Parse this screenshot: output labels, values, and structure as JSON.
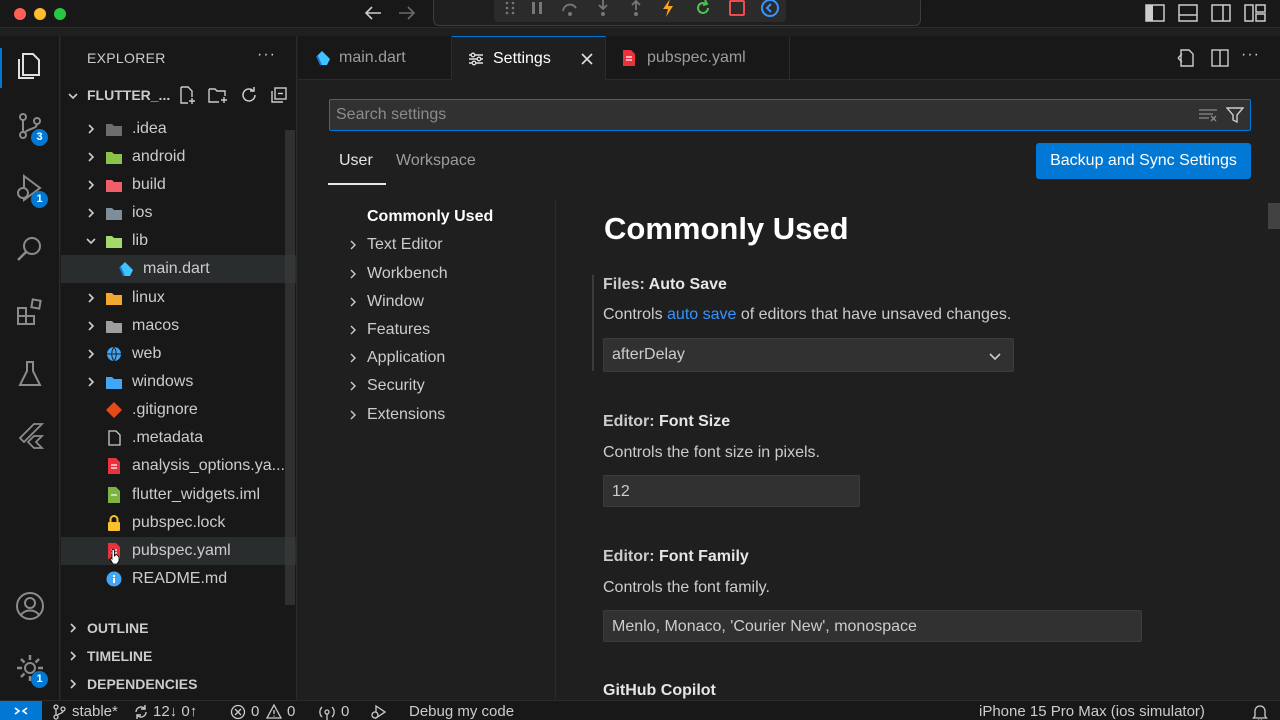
{
  "colors": {
    "accent": "#0078d4",
    "traffic_close": "#ff5f57",
    "traffic_min": "#febc2e",
    "traffic_max": "#28c840",
    "dart_blue": "#40c4ff",
    "yaml_red": "#e8323c"
  },
  "activity_bar": {
    "items": [
      {
        "name": "explorer-icon",
        "badge": ""
      },
      {
        "name": "source-control-icon",
        "badge": "3"
      },
      {
        "name": "run-debug-icon",
        "badge": "1"
      },
      {
        "name": "search-icon",
        "badge": ""
      },
      {
        "name": "extensions-icon",
        "badge": ""
      },
      {
        "name": "testing-icon",
        "badge": ""
      },
      {
        "name": "flutter-icon",
        "badge": ""
      }
    ],
    "accounts_icon": "account-icon",
    "manage_badge": "1"
  },
  "sidebar": {
    "title": "EXPLORER",
    "more": "···",
    "folder": "FLUTTER_...",
    "tree": [
      {
        "label": ".idea",
        "type": "folder",
        "expanded": false,
        "icon": "idea-folder-icon"
      },
      {
        "label": "android",
        "type": "folder",
        "expanded": false,
        "icon": "android-folder-icon"
      },
      {
        "label": "build",
        "type": "folder",
        "expanded": false,
        "icon": "build-folder-icon"
      },
      {
        "label": "ios",
        "type": "folder",
        "expanded": false,
        "icon": "ios-folder-icon"
      },
      {
        "label": "lib",
        "type": "folder",
        "expanded": true,
        "icon": "lib-folder-icon"
      },
      {
        "label": "main.dart",
        "type": "file",
        "icon": "dart-file-icon",
        "selected": true
      },
      {
        "label": "linux",
        "type": "folder",
        "expanded": false,
        "icon": "linux-folder-icon"
      },
      {
        "label": "macos",
        "type": "folder",
        "expanded": false,
        "icon": "macos-folder-icon"
      },
      {
        "label": "web",
        "type": "folder",
        "expanded": false,
        "icon": "web-folder-icon"
      },
      {
        "label": "windows",
        "type": "folder",
        "expanded": false,
        "icon": "windows-folder-icon"
      },
      {
        "label": ".gitignore",
        "type": "file",
        "icon": "git-file-icon"
      },
      {
        "label": ".metadata",
        "type": "file",
        "icon": "file-icon"
      },
      {
        "label": "analysis_options.ya...",
        "type": "file",
        "icon": "yaml-file-icon"
      },
      {
        "label": "flutter_widgets.iml",
        "type": "file",
        "icon": "iml-file-icon"
      },
      {
        "label": "pubspec.lock",
        "type": "file",
        "icon": "lock-file-icon"
      },
      {
        "label": "pubspec.yaml",
        "type": "file",
        "icon": "yaml-file-icon",
        "hovered": true
      },
      {
        "label": "README.md",
        "type": "file",
        "icon": "info-file-icon"
      }
    ],
    "sections": [
      "OUTLINE",
      "TIMELINE",
      "DEPENDENCIES"
    ]
  },
  "tabs": [
    {
      "label": "main.dart",
      "icon": "dart-file-icon",
      "active": false
    },
    {
      "label": "Settings",
      "icon": "settings-tab-icon",
      "active": true
    },
    {
      "label": "pubspec.yaml",
      "icon": "yaml-file-icon",
      "active": false
    }
  ],
  "settings": {
    "search_placeholder": "Search settings",
    "scopes": [
      "User",
      "Workspace"
    ],
    "sync_button": "Backup and Sync Settings",
    "toc": [
      "Commonly Used",
      "Text Editor",
      "Workbench",
      "Window",
      "Features",
      "Application",
      "Security",
      "Extensions"
    ],
    "heading": "Commonly Used",
    "items": [
      {
        "category": "Files: ",
        "name": "Auto Save",
        "desc_pre": "Controls ",
        "desc_link": "auto save",
        "desc_post": " of editors that have unsaved changes.",
        "value": "afterDelay"
      },
      {
        "category": "Editor: ",
        "name": "Font Size",
        "desc": "Controls the font size in pixels.",
        "value": "12"
      },
      {
        "category": "Editor: ",
        "name": "Font Family",
        "desc": "Controls the font family.",
        "value": "Menlo, Monaco, 'Courier New', monospace"
      },
      {
        "category": "",
        "name": "GitHub Copilot"
      }
    ]
  },
  "statusbar": {
    "branch": "stable*",
    "sync": "12↓ 0↑",
    "errors": "0",
    "warnings": "0",
    "ports": "0",
    "debug": "Debug my code",
    "device": "iPhone 15 Pro Max (ios simulator)"
  }
}
